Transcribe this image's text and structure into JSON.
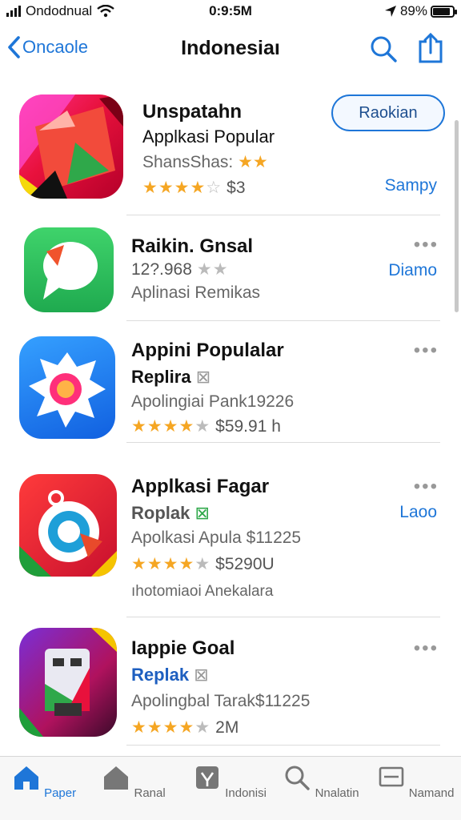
{
  "status": {
    "carrier": "Ondodnual",
    "time": "0:9:5M",
    "battery": "89%",
    "battery_level": 0.89
  },
  "nav": {
    "back_label": "Oncaole",
    "title": "Indonesiaı"
  },
  "items": [
    {
      "title": "Unspatahn",
      "subtitle": "Applkasi Popular",
      "meta": "ShansShas:",
      "stars_filled": 4,
      "price": "$3",
      "button": "Raokian",
      "action": "Sampy"
    },
    {
      "title": "Raikin. Gnsal",
      "meta": "12?.968",
      "subtitle": "Aplinasi Remikas",
      "action": "Diamo"
    },
    {
      "title": "Appini Populalar",
      "subtitle": "Replira",
      "meta": "Apolingiai Pank19226",
      "stars_filled": 4,
      "price": "$59.91 h"
    },
    {
      "title": "Applkasi Fagar",
      "subtitle": "Roplak",
      "meta": "Apolkasi Apula $11225",
      "stars_filled": 4.5,
      "price": "$5290U",
      "extra": "ıhotomiaoi Anekalara",
      "action": "Laoo"
    },
    {
      "title": "Iappie Goal",
      "subtitle": "Replak",
      "meta": "Apolingbal Tarak$11225",
      "stars_filled": 4.5,
      "price": "2M"
    }
  ],
  "tabs": [
    {
      "label": "Paper",
      "icon": "home-icon"
    },
    {
      "label": "Ranal",
      "icon": "house-icon"
    },
    {
      "label": "Indonisi",
      "icon": "apps-icon"
    },
    {
      "label": "Nnalatin",
      "icon": "search-icon"
    },
    {
      "label": "Namand",
      "icon": "updates-icon"
    }
  ],
  "colors": {
    "accent": "#1e76d8",
    "star": "#f5a623"
  }
}
